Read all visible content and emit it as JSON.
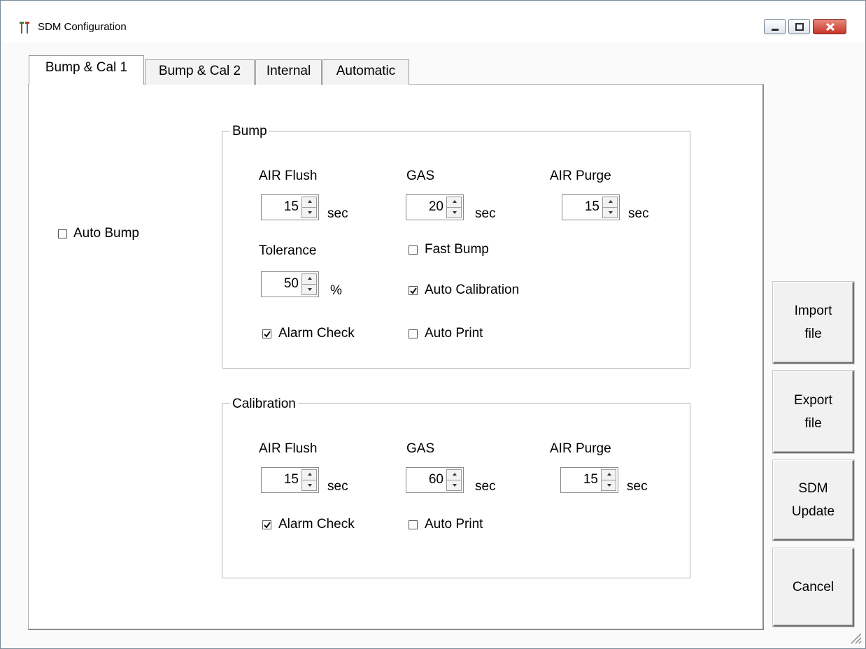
{
  "window": {
    "title": "SDM Configuration"
  },
  "tabs": [
    {
      "label": "Bump & Cal 1",
      "active": true
    },
    {
      "label": "Bump & Cal 2",
      "active": false
    },
    {
      "label": "Internal",
      "active": false
    },
    {
      "label": "Automatic",
      "active": false
    }
  ],
  "auto_bump": {
    "label": "Auto Bump",
    "checked": false
  },
  "bump": {
    "title": "Bump",
    "air_flush": {
      "label": "AIR Flush",
      "value": "15",
      "unit": "sec"
    },
    "gas": {
      "label": "GAS",
      "value": "20",
      "unit": "sec"
    },
    "air_purge": {
      "label": "AIR Purge",
      "value": "15",
      "unit": "sec"
    },
    "tolerance": {
      "label": "Tolerance",
      "value": "50",
      "unit": "%"
    },
    "fast_bump": {
      "label": "Fast Bump",
      "checked": false
    },
    "auto_calibration": {
      "label": "Auto Calibration",
      "checked": true
    },
    "alarm_check": {
      "label": "Alarm Check",
      "checked": true
    },
    "auto_print": {
      "label": "Auto Print",
      "checked": false
    }
  },
  "calibration": {
    "title": "Calibration",
    "air_flush": {
      "label": "AIR Flush",
      "value": "15",
      "unit": "sec"
    },
    "gas": {
      "label": "GAS",
      "value": "60",
      "unit": "sec"
    },
    "air_purge": {
      "label": "AIR Purge",
      "value": "15",
      "unit": "sec"
    },
    "alarm_check": {
      "label": "Alarm Check",
      "checked": true
    },
    "auto_print": {
      "label": "Auto Print",
      "checked": false
    }
  },
  "buttons": {
    "import_line1": "Import",
    "import_line2": "file",
    "export_line1": "Export",
    "export_line2": "file",
    "update_line1": "SDM",
    "update_line2": "Update",
    "cancel": "Cancel"
  },
  "colors": {
    "close_button": "#c8362a",
    "border": "#7a8a99"
  },
  "icons": [
    "app-tools-icon",
    "minimize-icon",
    "maximize-icon",
    "close-icon",
    "checkmark-icon",
    "resize-grip-icon"
  ]
}
